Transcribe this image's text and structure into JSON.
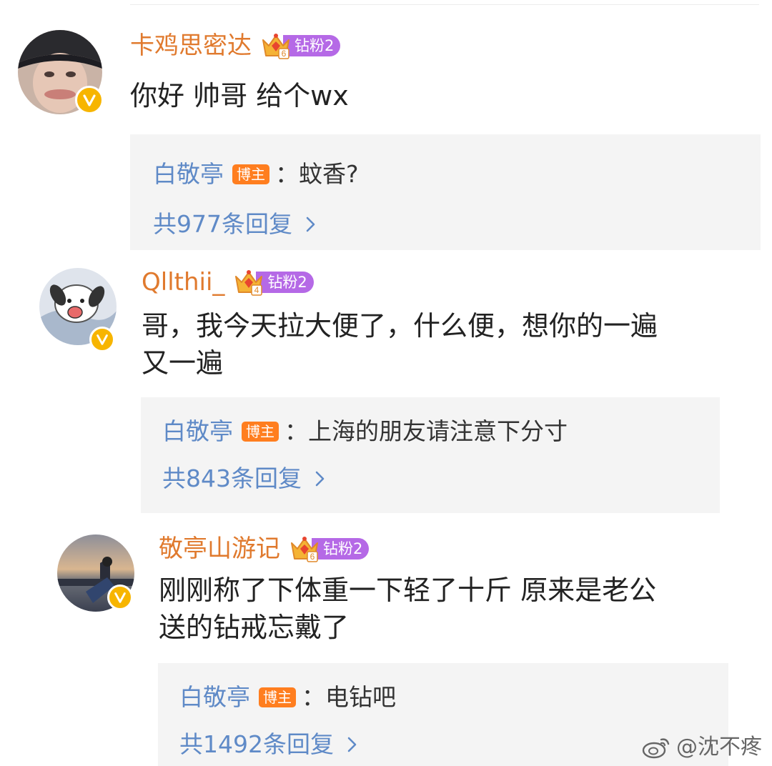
{
  "comments": [
    {
      "username": "卡鸡思密达",
      "fan_badge": "钻粉2",
      "crown_level": "6",
      "text_lines": [
        "你好 帅哥 给个wx"
      ],
      "reply": {
        "author": "白敬亭",
        "role_tag": "博主",
        "separator": "：",
        "text": "蚊香?",
        "count_label": "共977条回复"
      }
    },
    {
      "username": "Qllthii_",
      "fan_badge": "钻粉2",
      "crown_level": "4",
      "text_lines": [
        "哥，我今天拉大便了，什么便，想你的一遍",
        "又一遍"
      ],
      "reply": {
        "author": "白敬亭",
        "role_tag": "博主",
        "separator": "：",
        "text": "上海的朋友请注意下分寸",
        "count_label": "共843条回复"
      }
    },
    {
      "username": "敬亭山游记",
      "fan_badge": "钻粉2",
      "crown_level": "6",
      "text_lines": [
        "刚刚称了下体重一下轻了十斤  原来是老公",
        "送的钻戒忘戴了"
      ],
      "reply": {
        "author": "白敬亭",
        "role_tag": "博主",
        "separator": "：",
        "text": "电钻吧",
        "count_label": "共1492条回复"
      }
    }
  ],
  "watermark": {
    "text": "@沈不疼",
    "icon": "weibo-logo-icon"
  },
  "icons": {
    "verified": "verified-v-icon",
    "crown": "crown-icon",
    "chevron": "chevron-right-icon"
  },
  "colors": {
    "username": "#e07a2e",
    "reply_author": "#5f8ac7",
    "fan_badge": "#b569e6",
    "blogger_tag": "#ff7e1f",
    "verified_badge": "#f7b500",
    "reply_bg": "#f4f4f4"
  }
}
